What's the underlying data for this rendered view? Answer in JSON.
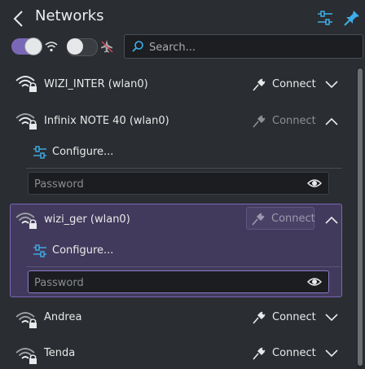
{
  "header": {
    "title": "Networks",
    "back_icon": "chevron-left-icon",
    "configure_icon": "configure-icon",
    "pin_icon": "pin-icon"
  },
  "toolbar": {
    "wifi_toggle_on": true,
    "wifi_icon": "wifi-icon",
    "airplane_toggle_on": false,
    "airplane_icon": "airplane-mode-icon",
    "search_placeholder": "Search..."
  },
  "networks": [
    {
      "ssid": "WIZI_INTER (wlan0)",
      "connect_label": "Connect",
      "expanded": false
    },
    {
      "ssid": "Infinix NOTE 40 (wlan0)",
      "connect_label": "Connect",
      "expanded": true,
      "configure_label": "Configure...",
      "password_placeholder": "Password"
    },
    {
      "ssid": "wizi_ger (wlan0)",
      "connect_label": "Connect",
      "expanded": true,
      "selected": true,
      "configure_label": "Configure...",
      "password_placeholder": "Password"
    },
    {
      "ssid": "Andrea",
      "connect_label": "Connect",
      "expanded": false
    },
    {
      "ssid": "Tenda",
      "connect_label": "Connect",
      "expanded": false
    }
  ],
  "colors": {
    "accent": "#3daee9",
    "selection_bg": "#423a5c",
    "selection_border": "#7a68b6",
    "toggle_on": "#7a68b6"
  }
}
